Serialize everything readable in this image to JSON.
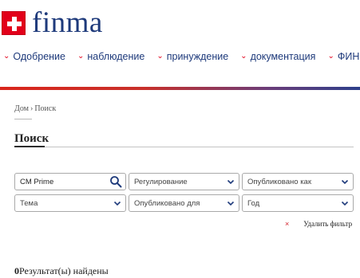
{
  "header": {
    "logo_text": "finma"
  },
  "nav": {
    "items": [
      {
        "label": "Одобрение"
      },
      {
        "label": "наблюдение"
      },
      {
        "label": "принуждение"
      },
      {
        "label": "документация"
      },
      {
        "label": "ФИНМА"
      }
    ]
  },
  "colors": {
    "brand_red": "#e2001a",
    "brand_blue": "#1e3a7b"
  },
  "breadcrumb": {
    "home": "Дом",
    "separator": "›",
    "current": "Поиск"
  },
  "page": {
    "title": "Поиск"
  },
  "filters": {
    "search_value": "CM Prime",
    "regulation": "Регулирование",
    "published_as": "Опубликовано как",
    "topic": "Тема",
    "published_for": "Опубликовано для",
    "year": "Год",
    "clear_icon": "×",
    "clear_label": "Удалить фильтр"
  },
  "results": {
    "count": "0",
    "text": "Результат(ы) найдены"
  }
}
